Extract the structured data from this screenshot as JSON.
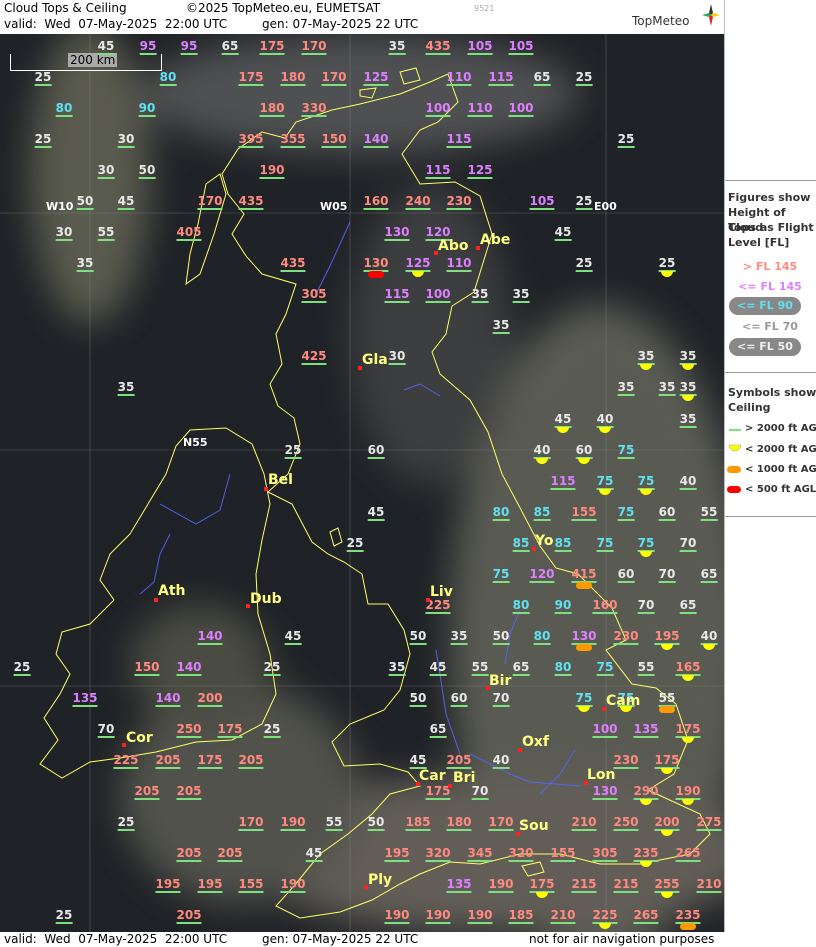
{
  "header": {
    "title": "Cloud Tops & Ceiling",
    "copyright": "©2025 TopMeteo.eu, EUMETSAT",
    "code": "9521",
    "logo": "TopMeteo",
    "valid": "valid:  Wed  07-May-2025  22:00 UTC",
    "gen": "gen: 07-May-2025 22 UTC"
  },
  "footer": {
    "valid": "valid:  Wed  07-May-2025  22:00 UTC",
    "gen": "gen: 07-May-2025 22 UTC",
    "note": "not for air navigation purposes"
  },
  "scale": "200 km",
  "legend": {
    "title1": "Figures show",
    "title2": "Height of Cloud",
    "title3": "Tops as Flight",
    "title4": "Level  [FL]",
    "fl145gt": "> FL 145",
    "fl145le": "<= FL 145",
    "fl90": "<= FL 90",
    "fl70": "<= FL 70",
    "fl50": "<= FL 50",
    "sym1": "Symbols show",
    "sym2": "Ceiling",
    "c2000gt": "> 2000 ft AGL",
    "c2000": "< 2000 ft AGL",
    "c1000": "< 1000 ft AGL",
    "c500": "< 500 ft AGL",
    "colors": {
      "gt145": "#ff8a80",
      "le145": "#dd80ff",
      "le90": "#60e0f0",
      "le70": "#e8e8e8",
      "le50": "#e8e8e8",
      "yellow": "#ffff00",
      "orange": "#ff9900",
      "red": "#ff0000",
      "green": "#7fe07f"
    }
  },
  "longitudes": [
    "W10",
    "W05",
    "E00",
    "N55"
  ],
  "cities": [
    "Abo",
    "Abe",
    "Gla",
    "Bel",
    "Ath",
    "Dub",
    "Liv",
    "Yo",
    "Bir",
    "Cam",
    "Oxf",
    "Car",
    "Bri",
    "Lon",
    "Cor",
    "Sou",
    "Ply"
  ],
  "values": [
    [
      "45",
      "w",
      106,
      40,
      ""
    ],
    [
      "95",
      "v2",
      148,
      40,
      ""
    ],
    [
      "95",
      "v2",
      189,
      40,
      ""
    ],
    [
      "65",
      "w",
      230,
      40,
      ""
    ],
    [
      "175",
      "p",
      272,
      40,
      ""
    ],
    [
      "170",
      "p",
      314,
      40,
      ""
    ],
    [
      "35",
      "w",
      397,
      40,
      ""
    ],
    [
      "435",
      "p",
      438,
      40,
      ""
    ],
    [
      "105",
      "v2",
      480,
      40,
      ""
    ],
    [
      "105",
      "v2",
      521,
      40,
      ""
    ],
    [
      "25",
      "w",
      43,
      71,
      ""
    ],
    [
      "80",
      "c",
      168,
      71,
      ""
    ],
    [
      "175",
      "p",
      251,
      71,
      ""
    ],
    [
      "180",
      "p",
      293,
      71,
      ""
    ],
    [
      "170",
      "p",
      334,
      71,
      ""
    ],
    [
      "125",
      "v2",
      376,
      71,
      ""
    ],
    [
      "110",
      "v2",
      459,
      71,
      ""
    ],
    [
      "115",
      "v2",
      501,
      71,
      ""
    ],
    [
      "65",
      "w",
      542,
      71,
      ""
    ],
    [
      "25",
      "w",
      584,
      71,
      ""
    ],
    [
      "80",
      "c",
      64,
      102,
      ""
    ],
    [
      "90",
      "c",
      147,
      102,
      ""
    ],
    [
      "180",
      "p",
      272,
      102,
      ""
    ],
    [
      "330",
      "p",
      314,
      102,
      ""
    ],
    [
      "100",
      "v2",
      438,
      102,
      ""
    ],
    [
      "110",
      "v2",
      480,
      102,
      ""
    ],
    [
      "100",
      "v2",
      521,
      102,
      ""
    ],
    [
      "25",
      "w",
      43,
      133,
      ""
    ],
    [
      "30",
      "w",
      126,
      133,
      ""
    ],
    [
      "395",
      "p",
      251,
      133,
      ""
    ],
    [
      "355",
      "p",
      293,
      133,
      ""
    ],
    [
      "150",
      "p",
      334,
      133,
      ""
    ],
    [
      "140",
      "v2",
      376,
      133,
      ""
    ],
    [
      "115",
      "v2",
      459,
      133,
      ""
    ],
    [
      "25",
      "w",
      626,
      133,
      ""
    ],
    [
      "30",
      "w",
      106,
      164,
      ""
    ],
    [
      "50",
      "w",
      147,
      164,
      ""
    ],
    [
      "190",
      "p",
      272,
      164,
      ""
    ],
    [
      "115",
      "v2",
      438,
      164,
      ""
    ],
    [
      "125",
      "v2",
      480,
      164,
      ""
    ],
    [
      "50",
      "w",
      85,
      195,
      ""
    ],
    [
      "45",
      "w",
      126,
      195,
      ""
    ],
    [
      "170",
      "p",
      210,
      195,
      ""
    ],
    [
      "435",
      "p",
      251,
      195,
      ""
    ],
    [
      "160",
      "p",
      376,
      195,
      ""
    ],
    [
      "240",
      "p",
      418,
      195,
      ""
    ],
    [
      "230",
      "p",
      459,
      195,
      ""
    ],
    [
      "105",
      "v2",
      542,
      195,
      ""
    ],
    [
      "25",
      "w",
      584,
      195,
      ""
    ],
    [
      "30",
      "w",
      64,
      226,
      ""
    ],
    [
      "55",
      "w",
      106,
      226,
      ""
    ],
    [
      "405",
      "p",
      189,
      226,
      ""
    ],
    [
      "130",
      "v2",
      397,
      226,
      ""
    ],
    [
      "120",
      "v2",
      438,
      226,
      ""
    ],
    [
      "45",
      "w",
      563,
      226,
      ""
    ],
    [
      "35",
      "w",
      85,
      257,
      ""
    ],
    [
      "435",
      "p",
      293,
      257,
      ""
    ],
    [
      "130",
      "p",
      376,
      257,
      "red"
    ],
    [
      "125",
      "v2",
      418,
      257,
      "yellow"
    ],
    [
      "110",
      "v2",
      459,
      257,
      ""
    ],
    [
      "25",
      "w",
      584,
      257,
      ""
    ],
    [
      "25",
      "w",
      667,
      257,
      "yellow"
    ],
    [
      "305",
      "p",
      314,
      288,
      ""
    ],
    [
      "115",
      "v2",
      397,
      288,
      ""
    ],
    [
      "100",
      "v2",
      438,
      288,
      ""
    ],
    [
      "35",
      "w",
      480,
      288,
      ""
    ],
    [
      "35",
      "w",
      521,
      288,
      ""
    ],
    [
      "35",
      "w",
      501,
      319,
      ""
    ],
    [
      "425",
      "p",
      314,
      350,
      ""
    ],
    [
      "30",
      "w",
      397,
      350,
      ""
    ],
    [
      "35",
      "w",
      646,
      350,
      "yellow"
    ],
    [
      "35",
      "w",
      688,
      350,
      "yellow"
    ],
    [
      "35",
      "w",
      126,
      381,
      ""
    ],
    [
      "35",
      "w",
      626,
      381,
      ""
    ],
    [
      "35",
      "w",
      667,
      381,
      ""
    ],
    [
      "35",
      "w",
      688,
      381,
      "yellow"
    ],
    [
      "45",
      "w",
      563,
      413,
      "yellow"
    ],
    [
      "40",
      "w",
      605,
      413,
      "yellow"
    ],
    [
      "35",
      "w",
      688,
      413,
      ""
    ],
    [
      "25",
      "w",
      293,
      444,
      ""
    ],
    [
      "60",
      "w",
      376,
      444,
      ""
    ],
    [
      "40",
      "w",
      542,
      444,
      "yellow"
    ],
    [
      "60",
      "w",
      584,
      444,
      "yellow"
    ],
    [
      "75",
      "c",
      626,
      444,
      ""
    ],
    [
      "115",
      "v2",
      563,
      475,
      ""
    ],
    [
      "75",
      "c",
      605,
      475,
      "yellow"
    ],
    [
      "75",
      "c",
      646,
      475,
      "yellow"
    ],
    [
      "40",
      "w",
      688,
      475,
      ""
    ],
    [
      "45",
      "w",
      376,
      506,
      ""
    ],
    [
      "80",
      "c",
      501,
      506,
      ""
    ],
    [
      "85",
      "c",
      542,
      506,
      ""
    ],
    [
      "155",
      "p",
      584,
      506,
      ""
    ],
    [
      "75",
      "c",
      626,
      506,
      ""
    ],
    [
      "60",
      "w",
      667,
      506,
      ""
    ],
    [
      "55",
      "w",
      709,
      506,
      ""
    ],
    [
      "25",
      "w",
      355,
      537,
      ""
    ],
    [
      "85",
      "c",
      521,
      537,
      ""
    ],
    [
      "85",
      "c",
      563,
      537,
      ""
    ],
    [
      "75",
      "c",
      605,
      537,
      ""
    ],
    [
      "75",
      "c",
      646,
      537,
      "yellow"
    ],
    [
      "70",
      "w",
      688,
      537,
      ""
    ],
    [
      "75",
      "c",
      501,
      568,
      ""
    ],
    [
      "120",
      "v2",
      542,
      568,
      ""
    ],
    [
      "415",
      "p",
      584,
      568,
      "orange"
    ],
    [
      "60",
      "w",
      626,
      568,
      ""
    ],
    [
      "70",
      "w",
      667,
      568,
      ""
    ],
    [
      "65",
      "w",
      709,
      568,
      ""
    ],
    [
      "225",
      "p",
      438,
      599,
      ""
    ],
    [
      "80",
      "c",
      521,
      599,
      ""
    ],
    [
      "90",
      "c",
      563,
      599,
      ""
    ],
    [
      "160",
      "p",
      605,
      599,
      ""
    ],
    [
      "70",
      "w",
      646,
      599,
      ""
    ],
    [
      "65",
      "w",
      688,
      599,
      ""
    ],
    [
      "140",
      "v2",
      210,
      630,
      ""
    ],
    [
      "45",
      "w",
      293,
      630,
      ""
    ],
    [
      "50",
      "w",
      418,
      630,
      ""
    ],
    [
      "35",
      "w",
      459,
      630,
      ""
    ],
    [
      "50",
      "w",
      501,
      630,
      ""
    ],
    [
      "80",
      "c",
      542,
      630,
      ""
    ],
    [
      "130",
      "v2",
      584,
      630,
      "orange"
    ],
    [
      "230",
      "p",
      626,
      630,
      ""
    ],
    [
      "195",
      "p",
      667,
      630,
      "yellow"
    ],
    [
      "40",
      "w",
      709,
      630,
      "yellow"
    ],
    [
      "25",
      "w",
      22,
      661,
      ""
    ],
    [
      "150",
      "p",
      147,
      661,
      ""
    ],
    [
      "140",
      "v2",
      189,
      661,
      ""
    ],
    [
      "25",
      "w",
      272,
      661,
      ""
    ],
    [
      "35",
      "w",
      397,
      661,
      ""
    ],
    [
      "45",
      "w",
      438,
      661,
      ""
    ],
    [
      "55",
      "w",
      480,
      661,
      ""
    ],
    [
      "65",
      "w",
      521,
      661,
      ""
    ],
    [
      "80",
      "c",
      563,
      661,
      ""
    ],
    [
      "75",
      "c",
      605,
      661,
      ""
    ],
    [
      "55",
      "w",
      646,
      661,
      ""
    ],
    [
      "165",
      "p",
      688,
      661,
      "yellow"
    ],
    [
      "135",
      "v2",
      85,
      692,
      ""
    ],
    [
      "140",
      "v2",
      168,
      692,
      ""
    ],
    [
      "200",
      "p",
      210,
      692,
      ""
    ],
    [
      "50",
      "w",
      418,
      692,
      ""
    ],
    [
      "60",
      "w",
      459,
      692,
      ""
    ],
    [
      "70",
      "w",
      501,
      692,
      ""
    ],
    [
      "75",
      "c",
      584,
      692,
      "yellow"
    ],
    [
      "75",
      "c",
      626,
      692,
      "yellow"
    ],
    [
      "55",
      "w",
      667,
      692,
      "orange"
    ],
    [
      "70",
      "w",
      106,
      723,
      ""
    ],
    [
      "250",
      "p",
      189,
      723,
      ""
    ],
    [
      "175",
      "p",
      230,
      723,
      ""
    ],
    [
      "25",
      "w",
      272,
      723,
      ""
    ],
    [
      "65",
      "w",
      438,
      723,
      ""
    ],
    [
      "100",
      "v2",
      605,
      723,
      ""
    ],
    [
      "135",
      "v2",
      646,
      723,
      ""
    ],
    [
      "175",
      "p",
      688,
      723,
      "yellow"
    ],
    [
      "225",
      "p",
      126,
      754,
      ""
    ],
    [
      "205",
      "p",
      168,
      754,
      ""
    ],
    [
      "175",
      "p",
      210,
      754,
      ""
    ],
    [
      "205",
      "p",
      251,
      754,
      ""
    ],
    [
      "45",
      "w",
      418,
      754,
      ""
    ],
    [
      "205",
      "p",
      459,
      754,
      ""
    ],
    [
      "40",
      "w",
      501,
      754,
      ""
    ],
    [
      "230",
      "p",
      626,
      754,
      ""
    ],
    [
      "175",
      "p",
      667,
      754,
      "yellow"
    ],
    [
      "205",
      "p",
      147,
      785,
      ""
    ],
    [
      "205",
      "p",
      189,
      785,
      ""
    ],
    [
      "175",
      "p",
      438,
      785,
      ""
    ],
    [
      "70",
      "w",
      480,
      785,
      ""
    ],
    [
      "130",
      "v2",
      605,
      785,
      ""
    ],
    [
      "290",
      "p",
      646,
      785,
      "yellow"
    ],
    [
      "190",
      "p",
      688,
      785,
      "yellow"
    ],
    [
      "25",
      "w",
      126,
      816,
      ""
    ],
    [
      "170",
      "p",
      251,
      816,
      ""
    ],
    [
      "190",
      "p",
      293,
      816,
      ""
    ],
    [
      "55",
      "w",
      334,
      816,
      ""
    ],
    [
      "50",
      "w",
      376,
      816,
      ""
    ],
    [
      "185",
      "p",
      418,
      816,
      ""
    ],
    [
      "180",
      "p",
      459,
      816,
      ""
    ],
    [
      "170",
      "p",
      501,
      816,
      ""
    ],
    [
      "210",
      "p",
      584,
      816,
      ""
    ],
    [
      "250",
      "p",
      626,
      816,
      ""
    ],
    [
      "200",
      "p",
      667,
      816,
      "yellow"
    ],
    [
      "275",
      "p",
      709,
      816,
      ""
    ],
    [
      "205",
      "p",
      189,
      847,
      ""
    ],
    [
      "205",
      "p",
      230,
      847,
      ""
    ],
    [
      "45",
      "w",
      314,
      847,
      ""
    ],
    [
      "195",
      "p",
      397,
      847,
      ""
    ],
    [
      "320",
      "p",
      438,
      847,
      ""
    ],
    [
      "345",
      "p",
      480,
      847,
      ""
    ],
    [
      "320",
      "p",
      521,
      847,
      ""
    ],
    [
      "155",
      "p",
      563,
      847,
      ""
    ],
    [
      "305",
      "p",
      605,
      847,
      ""
    ],
    [
      "235",
      "p",
      646,
      847,
      "yellow"
    ],
    [
      "265",
      "p",
      688,
      847,
      ""
    ],
    [
      "195",
      "p",
      168,
      878,
      ""
    ],
    [
      "195",
      "p",
      210,
      878,
      ""
    ],
    [
      "155",
      "p",
      251,
      878,
      ""
    ],
    [
      "190",
      "p",
      293,
      878,
      ""
    ],
    [
      "135",
      "v2",
      459,
      878,
      ""
    ],
    [
      "190",
      "p",
      501,
      878,
      ""
    ],
    [
      "175",
      "p",
      542,
      878,
      "yellow"
    ],
    [
      "215",
      "p",
      584,
      878,
      ""
    ],
    [
      "215",
      "p",
      626,
      878,
      ""
    ],
    [
      "255",
      "p",
      667,
      878,
      "yellow"
    ],
    [
      "210",
      "p",
      709,
      878,
      ""
    ],
    [
      "25",
      "w",
      64,
      909,
      ""
    ],
    [
      "205",
      "p",
      189,
      909,
      ""
    ],
    [
      "190",
      "p",
      397,
      909,
      ""
    ],
    [
      "190",
      "p",
      438,
      909,
      ""
    ],
    [
      "190",
      "p",
      480,
      909,
      ""
    ],
    [
      "185",
      "p",
      521,
      909,
      ""
    ],
    [
      "210",
      "p",
      563,
      909,
      ""
    ],
    [
      "225",
      "p",
      605,
      909,
      "yellow"
    ],
    [
      "265",
      "p",
      646,
      909,
      ""
    ],
    [
      "235",
      "p",
      688,
      909,
      "orange"
    ]
  ]
}
